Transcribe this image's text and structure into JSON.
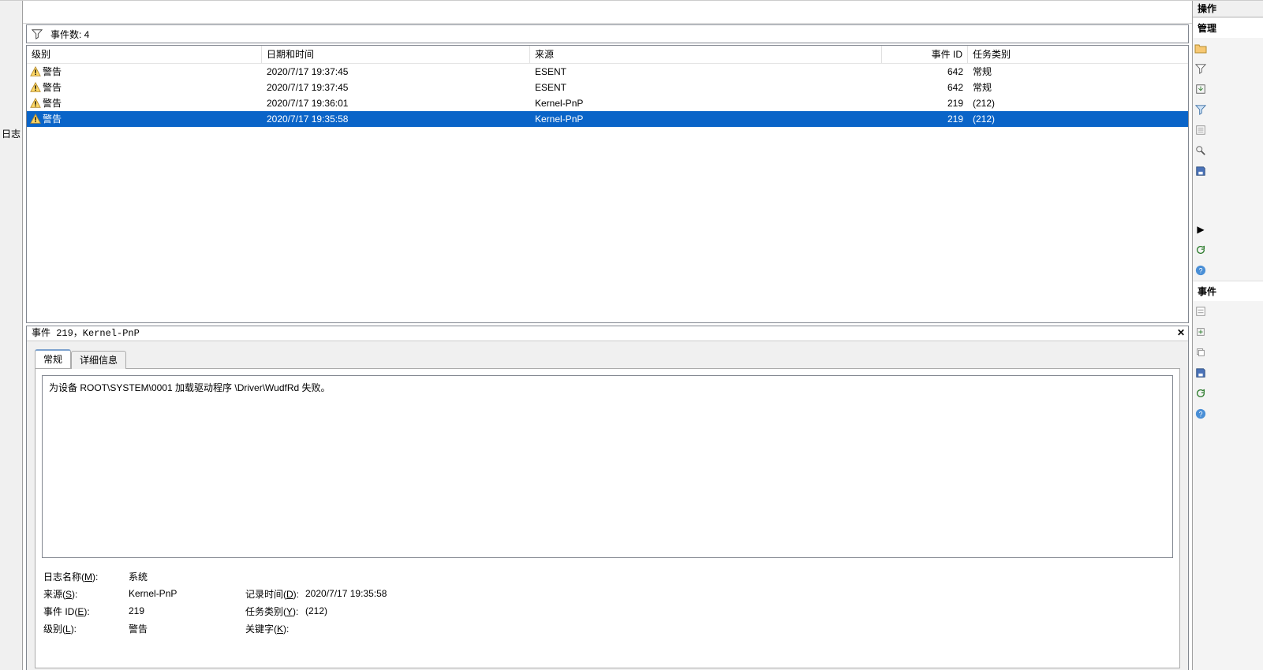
{
  "left_sliver": {
    "label": "日志"
  },
  "filter": {
    "label_prefix": "事件数: ",
    "count": "4"
  },
  "columns": {
    "level": "级别",
    "date": "日期和时间",
    "source": "来源",
    "id": "事件 ID",
    "task": "任务类别"
  },
  "events": [
    {
      "level": "警告",
      "date": "2020/7/17 19:37:45",
      "source": "ESENT",
      "id": "642",
      "task": "常规",
      "selected": false
    },
    {
      "level": "警告",
      "date": "2020/7/17 19:37:45",
      "source": "ESENT",
      "id": "642",
      "task": "常规",
      "selected": false
    },
    {
      "level": "警告",
      "date": "2020/7/17 19:36:01",
      "source": "Kernel-PnP",
      "id": "219",
      "task": "(212)",
      "selected": false
    },
    {
      "level": "警告",
      "date": "2020/7/17 19:35:58",
      "source": "Kernel-PnP",
      "id": "219",
      "task": "(212)",
      "selected": true
    }
  ],
  "details": {
    "title": "事件 219，Kernel-PnP",
    "tabs": {
      "general": "常规",
      "details": "详细信息"
    },
    "message": "为设备 ROOT\\SYSTEM\\0001 加载驱动程序 \\Driver\\WudfRd 失败。",
    "fields": {
      "log_name_label": "日志名称(",
      "log_name_u": "M",
      "log_name_after": "):",
      "log_name_value": "系统",
      "source_label": "来源(",
      "source_u": "S",
      "source_after": "):",
      "source_value": "Kernel-PnP",
      "rectime_label": "记录时间(",
      "rectime_u": "D",
      "rectime_after": "):",
      "rectime_value": "2020/7/17 19:35:58",
      "eventid_label": "事件 ID(",
      "eventid_u": "E",
      "eventid_after": "):",
      "eventid_value": "219",
      "taskcat_label": "任务类别(",
      "taskcat_u": "Y",
      "taskcat_after": "):",
      "taskcat_value": "(212)",
      "level_label": "级别(",
      "level_u": "L",
      "level_after": "):",
      "level_value": "警告",
      "keyword_label": "关键字(",
      "keyword_u": "K",
      "keyword_after": "):"
    }
  },
  "actions": {
    "header": "操作",
    "section1": "管理",
    "section2": "事件"
  }
}
